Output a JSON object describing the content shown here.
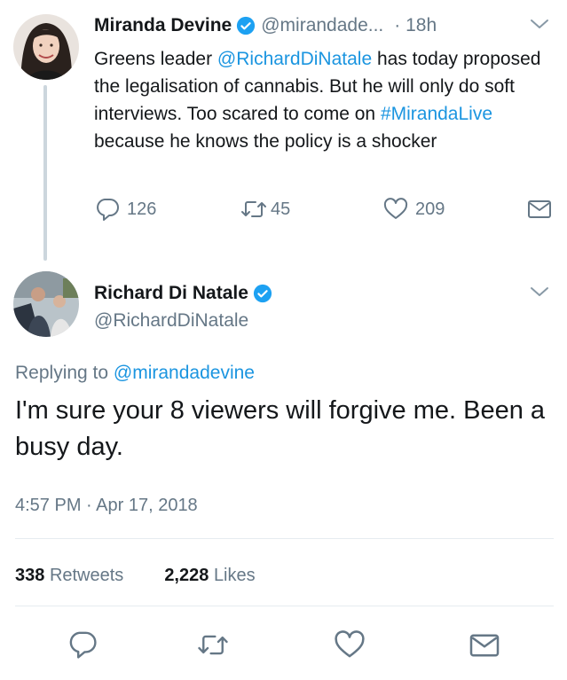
{
  "colors": {
    "link": "#1b95e0",
    "muted": "#657786",
    "text": "#14171a",
    "verified": "#1da1f2",
    "thread_line": "#ccd6dd",
    "divider": "#e6ecf0"
  },
  "parent_tweet": {
    "author_name": "Miranda Devine",
    "handle": "@mirandade...",
    "time": "· 18h",
    "text_segments": {
      "s1": "Greens leader ",
      "mention": "@RichardDiNatale",
      "s2": " has today proposed the legalisation of cannabis. But he will only do soft interviews. Too scared  to come on ",
      "hashtag": "#MirandaLive",
      "s3": " because he knows the policy is a shocker"
    },
    "actions": {
      "replies": "126",
      "retweets": "45",
      "likes": "209"
    }
  },
  "main_tweet": {
    "author_name": "Richard Di Natale",
    "handle": "@RichardDiNatale",
    "replying_prefix": "Replying to ",
    "replying_to": "@mirandadevine",
    "text": "I'm sure your 8 viewers will forgive me. Been a busy day.",
    "timestamp": "4:57 PM · Apr 17, 2018",
    "stats": {
      "retweets_count": "338",
      "retweets_label": "Retweets",
      "likes_count": "2,228",
      "likes_label": "Likes"
    }
  },
  "icons": {
    "verified": "verified-badge-icon",
    "chevron": "chevron-down-icon",
    "reply": "reply-icon",
    "retweet": "retweet-icon",
    "like": "heart-icon",
    "message": "envelope-icon"
  }
}
